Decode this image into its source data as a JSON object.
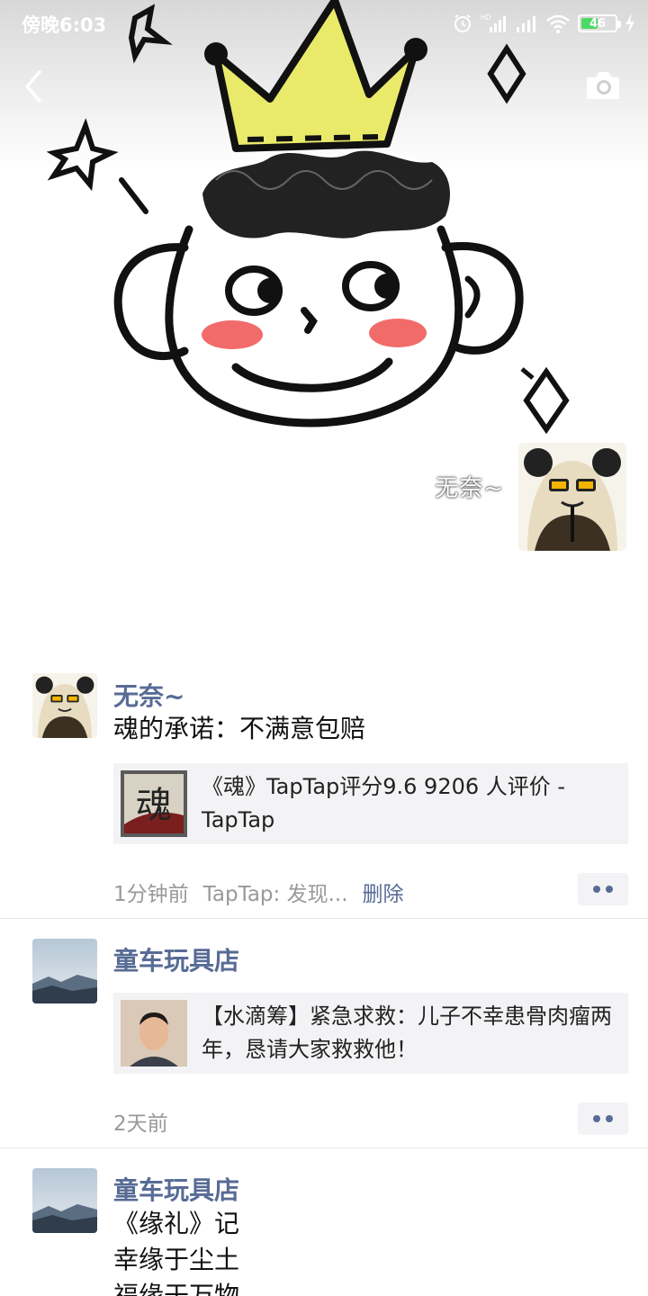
{
  "status_bar": {
    "time": "傍晚6:03",
    "network_label": "HD",
    "battery_level": "46"
  },
  "cover": {
    "username": "无奈~"
  },
  "posts": [
    {
      "name": "无奈~",
      "text": "魂的承诺：不满意包赔",
      "link": {
        "title": "《魂》TapTap评分9.6 9206 人评价 - TapTap",
        "thumb_glyph": "魂"
      },
      "time": "1分钟前",
      "source": "TapTap: 发现...",
      "delete": "删除"
    },
    {
      "name": "童车玩具店",
      "link": {
        "title": "【水滴筹】紧急求救：儿子不幸患骨肉瘤两年，恳请大家救救他！"
      },
      "time": "2天前"
    },
    {
      "name": "童车玩具店",
      "lines": [
        "《缘礼》记",
        "幸缘于尘土",
        "福缘于万物"
      ]
    }
  ],
  "icons": {
    "back": "back-arrow-icon",
    "camera": "camera-icon",
    "more": "more-dots-icon",
    "wifi": "wifi-icon",
    "signal": "signal-icon",
    "alarm": "alarm-icon",
    "battery": "battery-icon",
    "charging": "charging-icon"
  }
}
